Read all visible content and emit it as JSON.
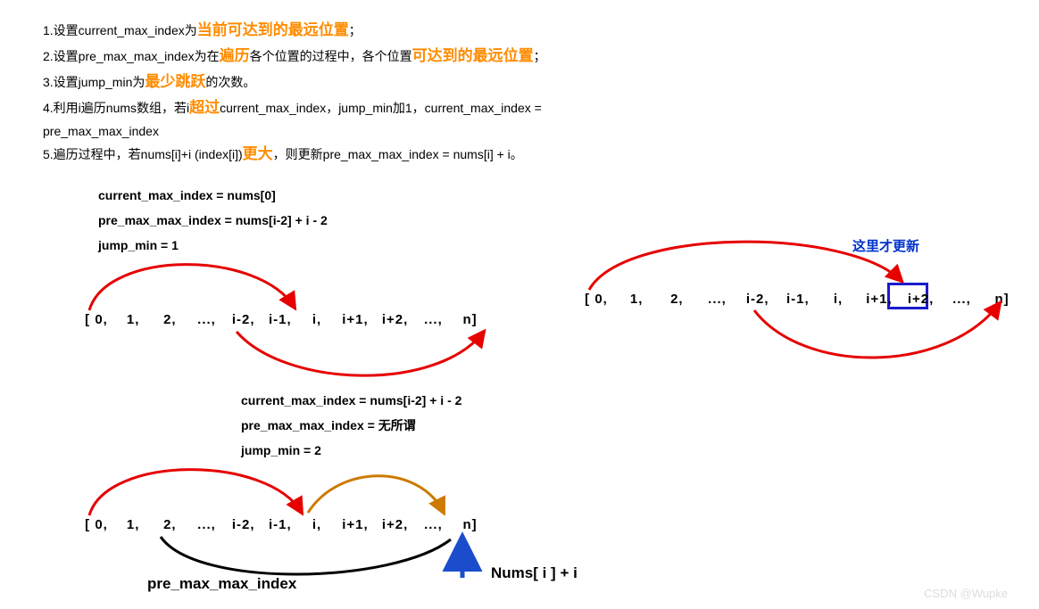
{
  "instructions": {
    "line1_a": "1.设置current_max_index为",
    "line1_b": "当前可达到的最远位置",
    "line1_c": "；",
    "line2_a": "2.设置pre_max_max_index为在",
    "line2_b": "遍历",
    "line2_c": "各个位置的过程中，各个位置",
    "line2_d": "可达到的最远位置",
    "line2_e": "；",
    "line3_a": "3.设置jump_min为",
    "line3_b": "最少跳跃",
    "line3_c": "的次数。",
    "line4_a": "4.利用i遍历nums数组，若i",
    "line4_b": "超过",
    "line4_c": "current_max_index，jump_min加1，current_max_index =",
    "line4_d": "pre_max_max_index",
    "line5_a": "5.遍历过程中，若nums[i]+i (index[i])",
    "line5_b": "更大",
    "line5_c": "，则更新pre_max_max_index = nums[i] + i。"
  },
  "block1": {
    "l1": "current_max_index = nums[0]",
    "l2": "pre_max_max_index = nums[i-2] + i - 2",
    "l3": "jump_min = 1"
  },
  "block2": {
    "l1": "current_max_index = nums[i-2] + i - 2",
    "l2": "pre_max_max_index =  无所谓",
    "l3": "jump_min =  2"
  },
  "callout": "这里才更新",
  "arrays": {
    "a": [
      "[ 0,",
      "1,",
      "2,",
      "...,",
      "i-2,",
      "i-1,",
      "i,",
      "i+1,",
      "i+2,",
      "...,",
      "n]"
    ],
    "b": [
      "[ 0,",
      "1,",
      "2,",
      "...,",
      "i-2,",
      "i-1,",
      "i,",
      "i+1,",
      "i+2,",
      "...,",
      "n]"
    ],
    "c": [
      "[ 0,",
      "1,",
      "2,",
      "...,",
      "i-2,",
      "i-1,",
      "i,",
      "i+1,",
      "i+2,",
      "...,",
      "n]"
    ]
  },
  "labels": {
    "pre": "pre_max_max_index",
    "nums": "Nums[ i ] + i"
  },
  "watermark": "CSDN @Wupke"
}
